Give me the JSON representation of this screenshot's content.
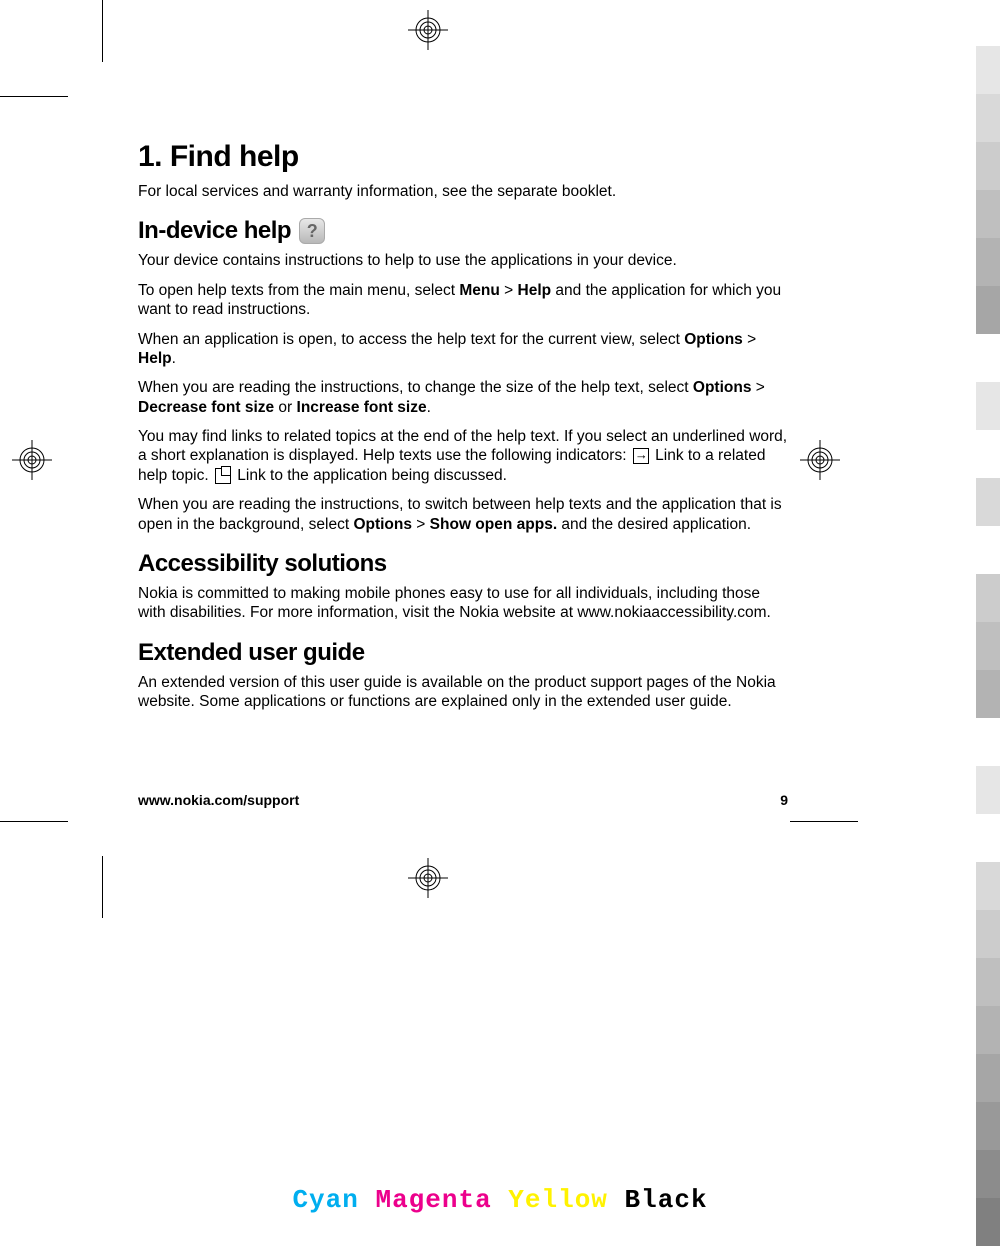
{
  "heading": "1.   Find help",
  "intro": "For local services and warranty information, see the separate booklet.",
  "section1": {
    "title": "In-device help",
    "p1": "Your device contains instructions to help to use the applications in your device.",
    "p2a": "To open help texts from the main menu, select ",
    "p2b": "Menu",
    "p2c": " > ",
    "p2d": "Help",
    "p2e": " and the application for which you want to read instructions.",
    "p3a": "When an application is open, to access the help text for the current view, select ",
    "p3b": "Options",
    "p3c": " > ",
    "p3d": "Help",
    "p3e": ".",
    "p4a": "When you are reading the instructions, to change the size of the help text, select ",
    "p4b": "Options",
    "p4c": " > ",
    "p4d": "Decrease font size",
    "p4e": " or ",
    "p4f": "Increase font size",
    "p4g": ".",
    "p5a": "You may find links to related topics at the end of the help text. If you select an underlined word, a short explanation is displayed. Help texts use the following indicators: ",
    "p5b": " Link to a related help topic. ",
    "p5c": " Link to the application being discussed.",
    "p6a": "When you are reading the instructions, to switch between help texts and the application that is open in the background, select ",
    "p6b": "Options",
    "p6c": " > ",
    "p6d": "Show open apps.",
    "p6e": " and the desired application."
  },
  "section2": {
    "title": "Accessibility solutions",
    "p1": "Nokia is committed to making mobile phones easy to use for all individuals, including those with disabilities. For more information, visit the Nokia website at www.nokiaaccessibility.com."
  },
  "section3": {
    "title": "Extended user guide",
    "p1": "An extended version of this user guide is available on the product support pages of the Nokia website. Some applications or functions are explained only in the extended user guide."
  },
  "footer": {
    "url": "www.nokia.com/support",
    "page": "9"
  },
  "cmyk": {
    "c": "Cyan",
    "m": "Magenta",
    "y": "Yellow",
    "k": "Black"
  },
  "bars": [
    "#e6e6e6",
    "#d9d9d9",
    "#cccccc",
    "#bfbfbf",
    "#b3b3b3",
    "#a6a6a6",
    "#ffffff",
    "#e6e6e6",
    "#ffffff",
    "#d9d9d9",
    "#ffffff",
    "#cccccc",
    "#bfbfbf",
    "#b3b3b3",
    "#ffffff",
    "#e6e6e6",
    "#ffffff",
    "#d9d9d9",
    "#cccccc",
    "#bfbfbf",
    "#b3b3b3",
    "#a6a6a6",
    "#999999",
    "#8c8c8c",
    "#808080"
  ]
}
